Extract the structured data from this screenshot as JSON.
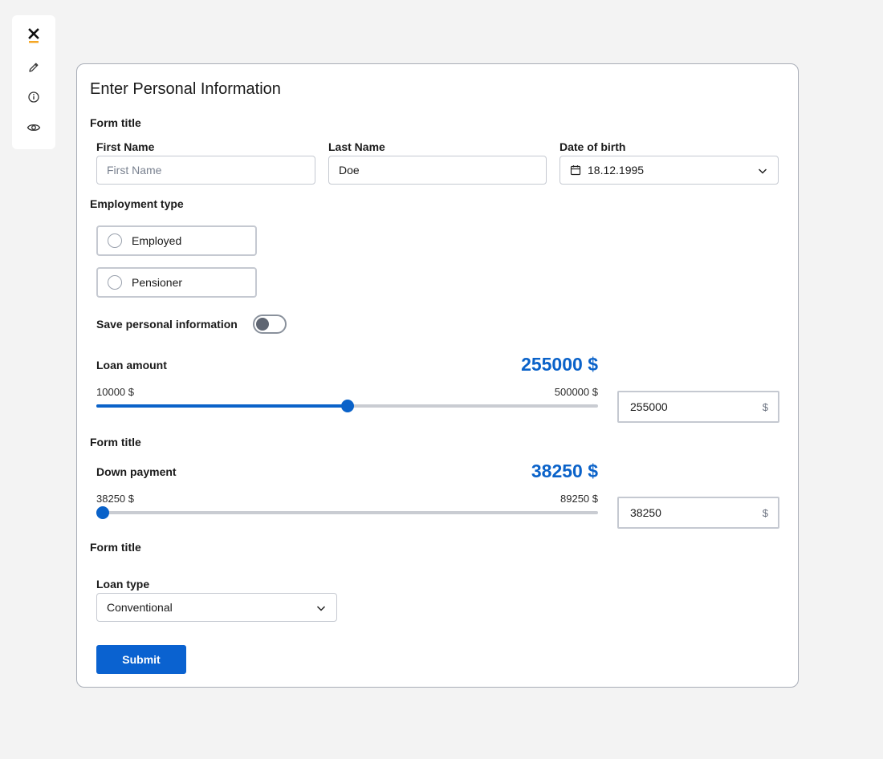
{
  "toolbar": {
    "icons": [
      "close-icon",
      "pencil-icon",
      "info-icon",
      "eye-icon"
    ],
    "accent": "#f5a623"
  },
  "form": {
    "title": "Enter Personal Information",
    "section1_title": "Form title",
    "first_name": {
      "label": "First Name",
      "value": "",
      "placeholder": "First Name"
    },
    "last_name": {
      "label": "Last Name",
      "value": "Doe",
      "placeholder": ""
    },
    "dob": {
      "label": "Date of birth",
      "value": "18.12.1995"
    },
    "employment": {
      "label": "Employment type",
      "options": [
        "Employed",
        "Pensioner"
      ]
    },
    "save_info": {
      "label": "Save personal information",
      "enabled": false
    },
    "loan_amount": {
      "label": "Loan amount",
      "display": "255000 $",
      "min_label": "10000 $",
      "max_label": "500000 $",
      "min": 10000,
      "max": 500000,
      "value": 255000,
      "input_value": "255000",
      "suffix": "$"
    },
    "section2_title": "Form title",
    "down_payment": {
      "label": "Down payment",
      "display": "38250 $",
      "min_label": "38250 $",
      "max_label": "89250 $",
      "min": 38250,
      "max": 89250,
      "value": 38250,
      "input_value": "38250",
      "suffix": "$"
    },
    "section3_title": "Form title",
    "loan_type": {
      "label": "Loan type",
      "value": "Conventional"
    },
    "submit_label": "Submit"
  },
  "colors": {
    "primary": "#0a62c9",
    "border": "#c5c9d1",
    "background": "#f3f3f3"
  }
}
